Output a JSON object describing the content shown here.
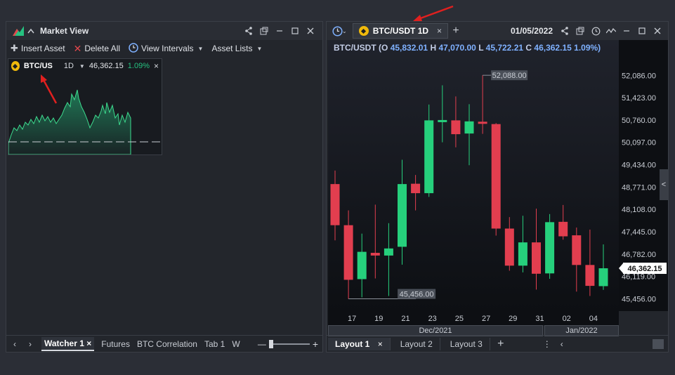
{
  "left_panel": {
    "title": "Market View",
    "toolbar": {
      "insert_asset": "Insert Asset",
      "delete_all": "Delete All",
      "view_intervals": "View Intervals",
      "asset_lists": "Asset Lists"
    },
    "mini_card": {
      "symbol": "BTC/US",
      "interval": "1D",
      "price": "46,362.15",
      "change": "1.09%",
      "close": "×"
    },
    "tabs": [
      "Watcher 1",
      "Futures",
      "BTC Correlation",
      "Tab 1",
      "W"
    ]
  },
  "right_panel": {
    "tab_label": "BTC/USDT 1D",
    "date": "01/05/2022",
    "ohlc": {
      "symbol": "BTC/USDT",
      "open_label": "(O",
      "open": "45,832.01",
      "high_label": "H",
      "high": "47,070.00",
      "low_label": "L",
      "low": "45,722.21",
      "close_label": "C",
      "close": "46,362.15",
      "change": "1.09%)"
    },
    "date_ticks": [
      "17",
      "19",
      "21",
      "23",
      "25",
      "27",
      "29",
      "31",
      "02",
      "04"
    ],
    "months": [
      "Dec/2021",
      "Jan/2022"
    ],
    "layout_tabs": [
      "Layout 1",
      "Layout 2",
      "Layout 3"
    ],
    "high_marker": "52,088.00",
    "low_marker": "45,456.00",
    "last_price": "46,362.15"
  },
  "colors": {
    "up": "#26d07c",
    "down": "#e23e4f",
    "last_price_bg": "#ffffff",
    "annotation_arrow": "#e0201f"
  },
  "chart_data": {
    "type": "candlestick",
    "ylim": [
      45300,
      52300
    ],
    "y_ticks": [
      "52,086.00",
      "51,423.00",
      "50,760.00",
      "50,097.00",
      "49,434.00",
      "48,771.00",
      "48,108.00",
      "47,445.00",
      "46,782.00",
      "46,119.00",
      "45,456.00"
    ],
    "y_tick_values": [
      52086,
      51423,
      50760,
      50097,
      49434,
      48771,
      48108,
      47445,
      46782,
      46119,
      45456
    ],
    "candles": [
      {
        "o": 48860,
        "h": 49260,
        "l": 47190,
        "c": 47640
      },
      {
        "o": 47640,
        "h": 48080,
        "l": 45456,
        "c": 46020
      },
      {
        "o": 46040,
        "h": 47390,
        "l": 45500,
        "c": 46850
      },
      {
        "o": 46820,
        "h": 48250,
        "l": 46060,
        "c": 46740
      },
      {
        "o": 46740,
        "h": 47700,
        "l": 45540,
        "c": 46950
      },
      {
        "o": 47000,
        "h": 49580,
        "l": 46470,
        "c": 48860
      },
      {
        "o": 48870,
        "h": 49130,
        "l": 48080,
        "c": 48590
      },
      {
        "o": 48590,
        "h": 51220,
        "l": 48480,
        "c": 50750
      },
      {
        "o": 50760,
        "h": 51790,
        "l": 50100,
        "c": 50760
      },
      {
        "o": 50750,
        "h": 51460,
        "l": 49950,
        "c": 50340
      },
      {
        "o": 50360,
        "h": 51230,
        "l": 49420,
        "c": 50720
      },
      {
        "o": 50710,
        "h": 52088,
        "l": 50350,
        "c": 50660
      },
      {
        "o": 50640,
        "h": 50670,
        "l": 47330,
        "c": 47540
      },
      {
        "o": 47540,
        "h": 47880,
        "l": 46290,
        "c": 46440
      },
      {
        "o": 46440,
        "h": 47920,
        "l": 46240,
        "c": 47130
      },
      {
        "o": 47130,
        "h": 48130,
        "l": 45730,
        "c": 46200
      },
      {
        "o": 46210,
        "h": 47970,
        "l": 46050,
        "c": 47730
      },
      {
        "o": 47740,
        "h": 48240,
        "l": 47210,
        "c": 47310
      },
      {
        "o": 47340,
        "h": 47570,
        "l": 45670,
        "c": 46460
      },
      {
        "o": 46460,
        "h": 47510,
        "l": 45540,
        "c": 45840
      },
      {
        "o": 45832.01,
        "h": 47070,
        "l": 45722.21,
        "c": 46362.15
      }
    ]
  }
}
